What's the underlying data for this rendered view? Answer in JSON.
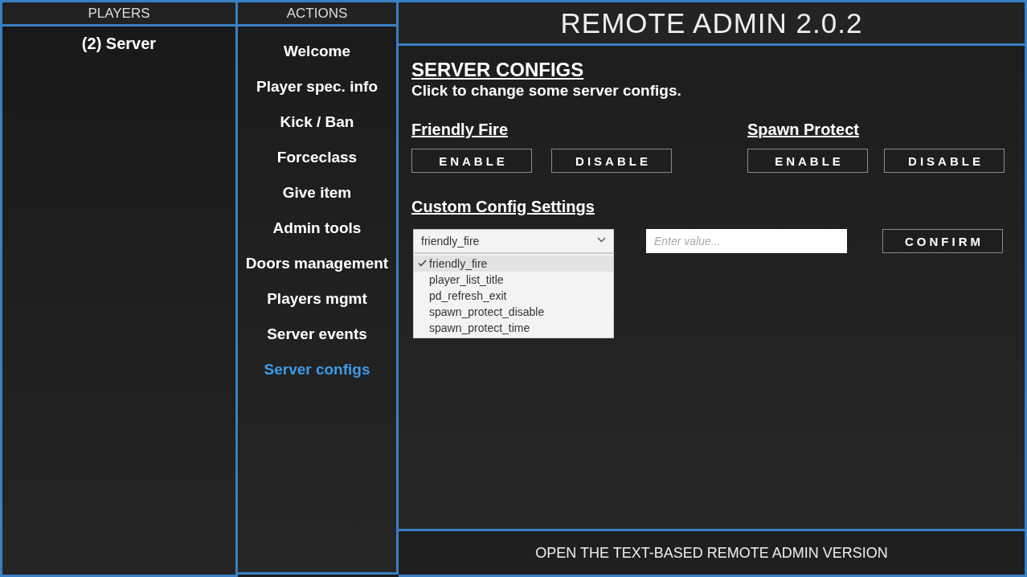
{
  "players_panel": {
    "title": "PLAYERS",
    "players": [
      "(2) Server"
    ]
  },
  "actions_panel": {
    "title": "ACTIONS",
    "items": [
      {
        "label": "Welcome",
        "selected": false
      },
      {
        "label": "Player spec. info",
        "selected": false
      },
      {
        "label": "Kick / Ban",
        "selected": false
      },
      {
        "label": "Forceclass",
        "selected": false
      },
      {
        "label": "Give item",
        "selected": false
      },
      {
        "label": "Admin tools",
        "selected": false
      },
      {
        "label": "Doors management",
        "selected": false
      },
      {
        "label": "Players mgmt",
        "selected": false
      },
      {
        "label": "Server events",
        "selected": false
      },
      {
        "label": "Server configs",
        "selected": true
      }
    ]
  },
  "header": {
    "title": "REMOTE ADMIN 2.0.2"
  },
  "content": {
    "heading": "SERVER CONFIGS",
    "subtitle": "Click to change some server configs.",
    "toggles": [
      {
        "label": "Friendly Fire",
        "buttons": [
          "ENABLE",
          "DISABLE"
        ]
      },
      {
        "label": "Spawn Protect",
        "buttons": [
          "ENABLE",
          "DISABLE"
        ]
      }
    ],
    "custom": {
      "heading": "Custom Config Settings",
      "dropdown": {
        "value": "friendly_fire",
        "expanded": true,
        "options": [
          {
            "label": "friendly_fire",
            "selected": true
          },
          {
            "label": "player_list_title",
            "selected": false
          },
          {
            "label": "pd_refresh_exit",
            "selected": false
          },
          {
            "label": "spawn_protect_disable",
            "selected": false
          },
          {
            "label": "spawn_protect_time",
            "selected": false
          }
        ]
      },
      "value_field": {
        "placeholder": "Enter value..."
      },
      "confirm_button": "CONFIRM"
    }
  },
  "footer": {
    "link": "OPEN THE TEXT-BASED REMOTE ADMIN VERSION"
  }
}
